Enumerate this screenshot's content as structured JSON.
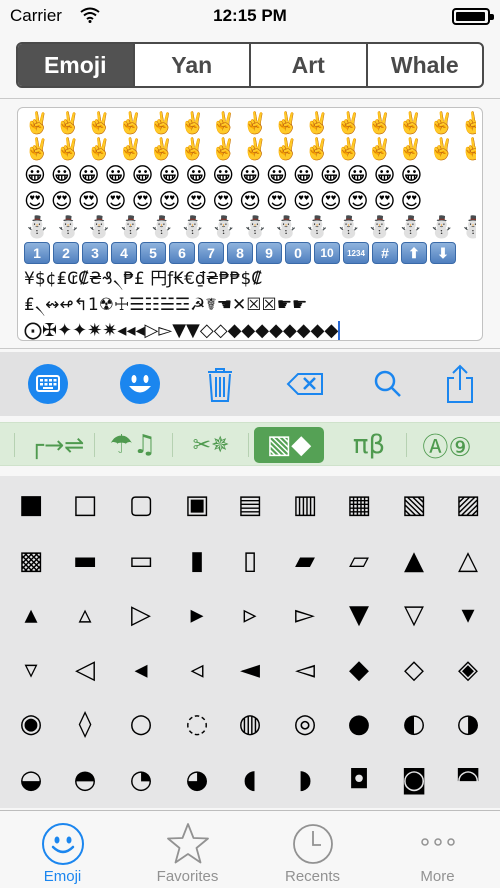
{
  "status_bar": {
    "carrier": "Carrier",
    "time": "12:15 PM",
    "battery_level": 0.95
  },
  "segments": {
    "items": [
      "Emoji",
      "Yan",
      "Art",
      "Whale"
    ],
    "selected": "Emoji"
  },
  "text_area": {
    "emoji_rows": [
      "✌️✌️✌️✌️✌️✌️✌️✌️✌️✌️✌️✌️✌️✌️✌️",
      "✌️✌️✌️✌️✌️✌️✌️✌️✌️✌️✌️✌️✌️✌️✌️",
      "😀😀😀😀😀😀😀😀😀😀😀😀😀😀😀",
      "😍😍😍😍😍😍😍😍😍😍😍😍😍😍😍",
      "⛄⛄⛄⛄⛄⛄⛄⛄⛄⛄⛄⛄⛄⛄⛄"
    ],
    "number_keys": [
      "1",
      "2",
      "3",
      "4",
      "5",
      "6",
      "7",
      "8",
      "9",
      "0",
      "10",
      "1234",
      "#",
      "⬆",
      "⬇"
    ],
    "symbol_rows": [
      "¥$¢₤₢₡₴₰৲₱£ 円ƒ₭€₫₴₱₱$₡",
      "₤৲↭↫↰1☢☩☰☷☱☲☭☤☚✕☒☒☛☛",
      "⨀✠✦✦✷✷◂◂◂▷▻▼▼◇◇◆◆◆◆◆◆◆◆"
    ]
  },
  "toolbar": {
    "icons": [
      "keyboard-icon",
      "emoji-face-icon",
      "trash-icon",
      "delete-backspace-icon",
      "search-icon",
      "share-icon"
    ]
  },
  "categories": {
    "items": [
      "┌→⇌",
      "☂♫",
      "✂✵",
      "▧◆",
      "πβ",
      "Ⓐ⑨"
    ],
    "selected_index": 3
  },
  "symbol_grid": {
    "rows": [
      [
        "■",
        "□",
        "▢",
        "▣",
        "▤",
        "▥",
        "▦",
        "▧",
        "▨"
      ],
      [
        "▩",
        "▬",
        "▭",
        "▮",
        "▯",
        "▰",
        "▱",
        "▲",
        "△"
      ],
      [
        "▴",
        "▵",
        "▷",
        "▸",
        "▹",
        "▻",
        "▼",
        "▽",
        "▾"
      ],
      [
        "▿",
        "◁",
        "◂",
        "◃",
        "◄",
        "◅",
        "◆",
        "◇",
        "◈"
      ],
      [
        "◉",
        "◊",
        "○",
        "◌",
        "◍",
        "◎",
        "●",
        "◐",
        "◑"
      ],
      [
        "◒",
        "◓",
        "◔",
        "◕",
        "◖",
        "◗",
        "◘",
        "◙",
        "◚"
      ]
    ]
  },
  "tab_bar": {
    "items": [
      {
        "label": "Emoji",
        "icon": "smiley-face-icon"
      },
      {
        "label": "Favorites",
        "icon": "star-icon"
      },
      {
        "label": "Recents",
        "icon": "clock-icon"
      },
      {
        "label": "More",
        "icon": "ellipsis-icon"
      }
    ],
    "selected": "Emoji"
  },
  "colors": {
    "accent_blue": "#1b86ef",
    "category_green": "#55a155",
    "category_bg": "#dcecd9"
  }
}
